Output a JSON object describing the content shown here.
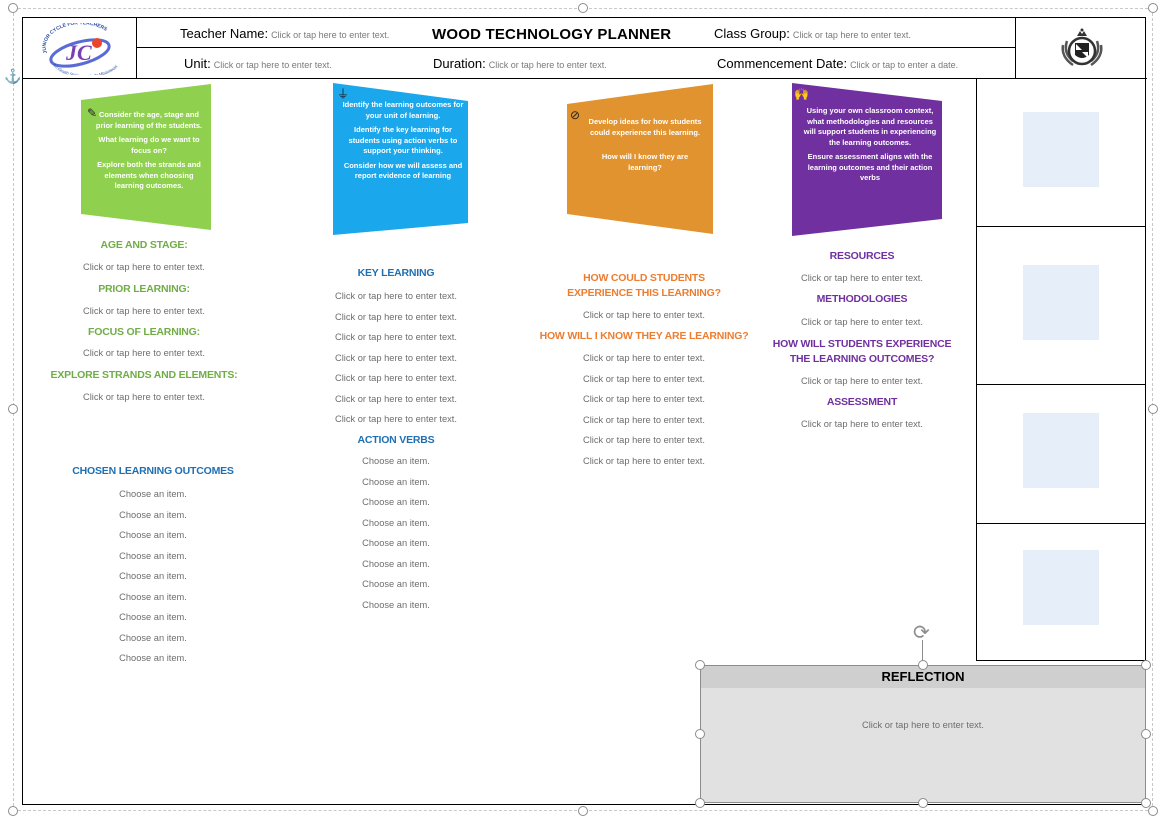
{
  "header": {
    "title": "WOOD TECHNOLOGY PLANNER",
    "teacher_label": "Teacher Name:",
    "unit_label": "Unit:",
    "duration_label": "Duration:",
    "class_group_label": "Class Group:",
    "commencement_label": "Commencement Date:",
    "text_placeholder": "Click or tap here to enter text.",
    "date_placeholder": "Click or tap to enter a date.",
    "logo_text_top": "JUNIOR CYCLE FOR TEACHERS",
    "logo_text_bottom": "An tSraith Shóisearach do Mhúinteoirí",
    "logo_mark": "JC"
  },
  "colors": {
    "green": "#8fd14f",
    "blue": "#1aa7ec",
    "orange": "#e0932e",
    "purple": "#7030a0"
  },
  "panels": {
    "green": [
      "Consider the age, stage and prior learning of the students.",
      "What learning do we want to focus on?",
      "Explore both the strands and elements when choosing learning outcomes."
    ],
    "blue": [
      "Identify the learning outcomes for your unit of learning.",
      "Identify the key learning for students using action verbs to support your thinking.",
      "Consider how we will assess and report evidence of learning"
    ],
    "orange": [
      "Develop ideas for how students could experience this learning.",
      "How will I know they are learning?"
    ],
    "purple": [
      "Using your own classroom context, what methodologies and resources will support students in experiencing the learning outcomes.",
      "Ensure assessment aligns with the learning outcomes and  their action verbs"
    ]
  },
  "col1": {
    "age_stage": "AGE AND STAGE:",
    "prior_learning": "PRIOR LEARNING:",
    "focus": "FOCUS OF LEARNING:",
    "explore": "EXPLORE STRANDS AND ELEMENTS:",
    "chosen_outcomes": "CHOSEN LEARNING OUTCOMES",
    "text_placeholder": "Click or tap here to enter text.",
    "choose_placeholder": "Choose an item."
  },
  "col2": {
    "key_learning": "KEY LEARNING",
    "action_verbs": "ACTION VERBS"
  },
  "col3": {
    "experience": "HOW COULD STUDENTS EXPERIENCE THIS LEARNING?",
    "know": "HOW WILL I KNOW THEY ARE LEARNING?"
  },
  "col4": {
    "resources": "RESOURCES",
    "methodologies": "METHODOLOGIES",
    "how_experience": "HOW WILL STUDENTS EXPERIENCE THE LEARNING OUTCOMES?",
    "assessment": "ASSESSMENT"
  },
  "reflection": {
    "title": "REFLECTION",
    "placeholder": "Click or tap here to enter text."
  }
}
